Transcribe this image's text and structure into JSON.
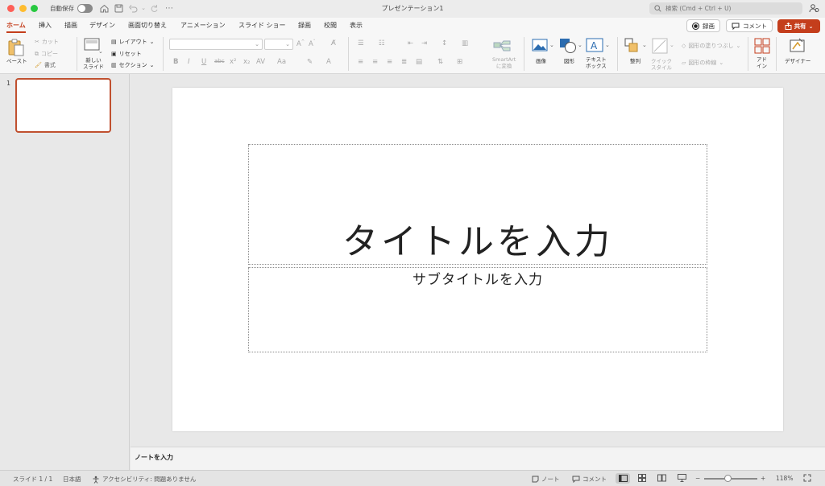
{
  "window": {
    "title": "プレゼンテーション1",
    "autosave_label": "自動保存",
    "search_placeholder": "検索 (Cmd + Ctrl + U)"
  },
  "tabs": [
    {
      "label": "ホーム",
      "active": true
    },
    {
      "label": "挿入"
    },
    {
      "label": "描画"
    },
    {
      "label": "デザイン"
    },
    {
      "label": "画面切り替え"
    },
    {
      "label": "アニメーション"
    },
    {
      "label": "スライド ショー"
    },
    {
      "label": "録画"
    },
    {
      "label": "校閲"
    },
    {
      "label": "表示"
    }
  ],
  "top_buttons": {
    "record": "録画",
    "comment": "コメント",
    "share": "共有"
  },
  "ribbon": {
    "paste": "ペースト",
    "cut": "カット",
    "copy": "コピー",
    "format": "書式",
    "new_slide": "新しい\nスライド",
    "layout": "レイアウト",
    "reset": "リセット",
    "section": "セクション",
    "smartart": "SmartArt\nに変換",
    "picture": "画像",
    "shapes": "図形",
    "textbox": "テキスト\nボックス",
    "arrange": "整列",
    "quick_styles": "クイック\nスタイル",
    "shape_fill": "図形の塗りつぶし",
    "shape_outline": "図形の枠線",
    "addins": "アド\nイン",
    "designer": "デザイナー",
    "font_glyphs": [
      "B",
      "I",
      "U",
      "abc",
      "x²",
      "x₂",
      "AV",
      "Aa",
      "A"
    ]
  },
  "thumbnails": {
    "number": "1"
  },
  "slide": {
    "title_placeholder": "タイトルを入力",
    "subtitle_placeholder": "サブタイトルを入力"
  },
  "notes": {
    "placeholder": "ノートを入力"
  },
  "status": {
    "slide_count": "スライド 1 / 1",
    "language": "日本語",
    "accessibility": "アクセシビリティ: 問題ありません",
    "notes": "ノート",
    "comments": "コメント",
    "zoom_minus": "−",
    "zoom_plus": "+",
    "zoom": "118%",
    "zoom_level": 0.45
  },
  "colors": {
    "accent": "#c43e1c",
    "thumb_border": "#c0502f",
    "close": "#fe5f57",
    "minimize": "#febc2e",
    "maximize": "#28c840"
  }
}
